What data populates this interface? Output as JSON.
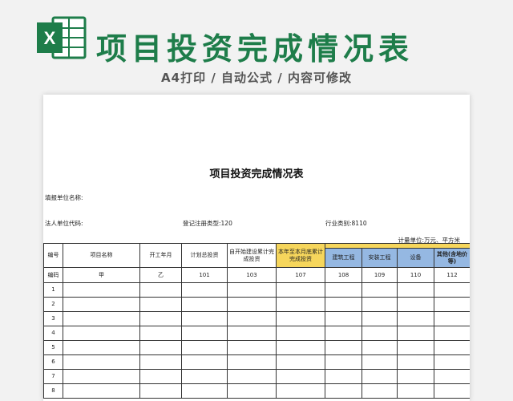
{
  "banner": {
    "logo_letter": "X",
    "title": "项目投资完成情况表",
    "subtitle": "A4打印 / 自动公式 / 内容可修改"
  },
  "sheet": {
    "title": "项目投资完成情况表",
    "meta": {
      "unit_name": "填报单位名称:",
      "legal_code": "法人单位代码:",
      "reg_type": "登记注册类型:120",
      "industry": "行业类别:8110",
      "measure": "计量单位:万元、平方米"
    },
    "columns": [
      "编号",
      "项目名称",
      "开工年月",
      "计划总投资",
      "自开始建设累计完成投资",
      "本年至本月底累计完成投资",
      "建筑工程",
      "安装工程",
      "设备",
      "其他(含地价等)"
    ],
    "codes": [
      "编码",
      "甲",
      "乙",
      "101",
      "103",
      "107",
      "108",
      "109",
      "110",
      "112"
    ],
    "row_numbers": [
      "1",
      "2",
      "3",
      "4",
      "5",
      "6",
      "7",
      "8"
    ]
  },
  "colors": {
    "title_green": "#1e7d4a",
    "header_yellow": "#f6d65c",
    "header_blue": "#95b8e2"
  }
}
